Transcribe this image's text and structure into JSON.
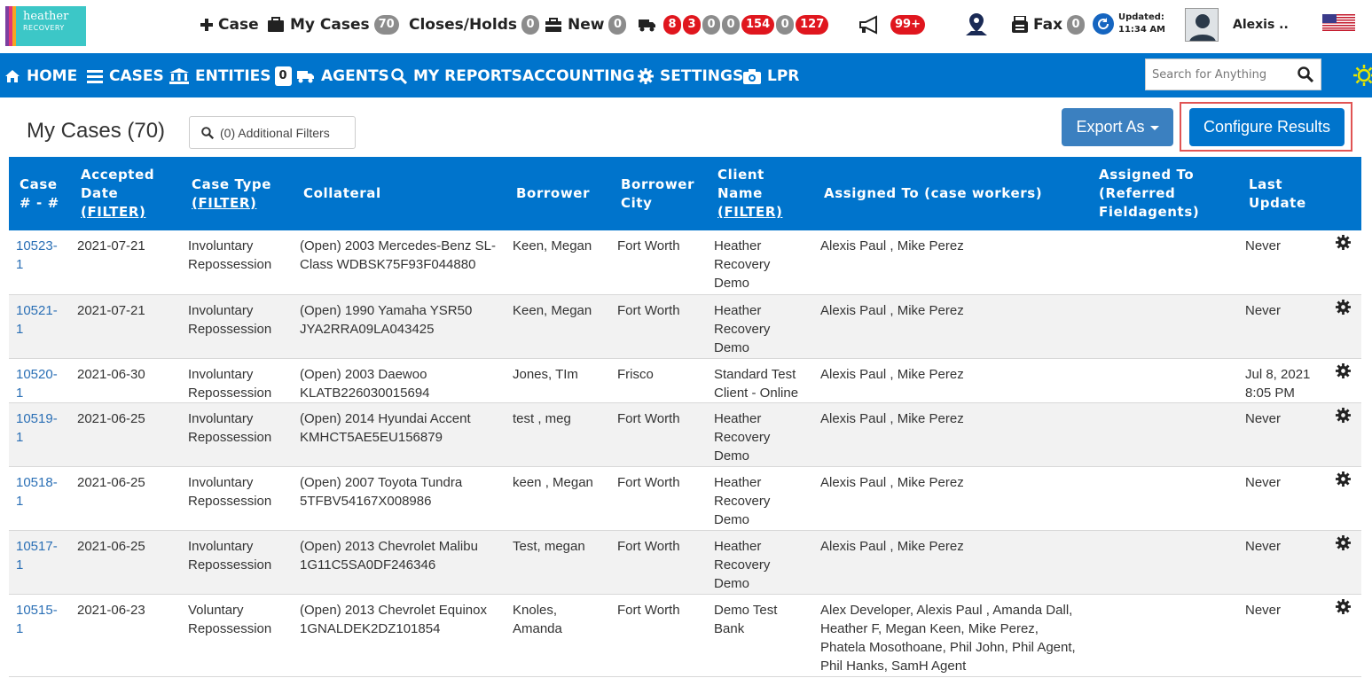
{
  "logo": {
    "line1": "heather",
    "line2": "RECOVERY",
    "stripes": [
      "#7b3fa0",
      "#e0367a",
      "#f5a623",
      "#3cc7c7"
    ]
  },
  "topbar": {
    "new_case_label": "Case",
    "my_cases_label": "My Cases",
    "my_cases_count": "70",
    "closes_holds_label": "Closes/Holds",
    "closes_holds_count": "0",
    "new_label": "New",
    "new_count": "0",
    "truck_counts": [
      "8",
      "3",
      "0",
      "0",
      "154",
      "0",
      "127"
    ],
    "notifications_count": "99+",
    "fax_label": "Fax",
    "fax_count": "0",
    "updated_label": "Updated:",
    "updated_time": "11:34 AM",
    "user_name": "Alexis .."
  },
  "nav": {
    "home": "HOME",
    "cases": "CASES",
    "entities": "ENTITIES",
    "entities_count": "0",
    "agents": "AGENTS",
    "my_reports": "MY REPORTS",
    "accounting": "ACCOUNTING",
    "settings": "SETTINGS",
    "lpr": "LPR",
    "search_placeholder": "Search for Anything"
  },
  "page": {
    "title": "My Cases (70)",
    "filters_label": "(0) Additional Filters",
    "export_label": "Export As",
    "configure_label": "Configure Results"
  },
  "table": {
    "headers": {
      "case": "Case # - #",
      "accepted": "Accepted Date",
      "case_type": "Case Type",
      "collateral": "Collateral",
      "borrower": "Borrower",
      "borrower_city": "Borrower City",
      "client": "Client Name",
      "assigned": "Assigned To (case workers)",
      "referred": "Assigned To (Referred Fieldagents)",
      "last_update": "Last Update",
      "filter": "(FILTER)"
    },
    "rows": [
      {
        "case": "10523-1",
        "accepted": "2021-07-21",
        "case_type": "Involuntary Repossession",
        "collateral": "(Open) 2003 Mercedes-Benz SL-Class WDBSK75F93F044880",
        "borrower": "Keen, Megan",
        "city": "Fort Worth",
        "client": "Heather Recovery Demo",
        "assigned": "Alexis Paul , Mike Perez",
        "referred": "",
        "last_update": "Never"
      },
      {
        "case": "10521-1",
        "accepted": "2021-07-21",
        "case_type": "Involuntary Repossession",
        "collateral": "(Open) 1990 Yamaha YSR50 JYA2RRA09LA043425",
        "borrower": "Keen, Megan",
        "city": "Fort Worth",
        "client": "Heather Recovery Demo",
        "assigned": "Alexis Paul , Mike Perez",
        "referred": "",
        "last_update": "Never"
      },
      {
        "case": "10520-1",
        "accepted": "2021-06-30",
        "case_type": "Involuntary Repossession",
        "collateral": "(Open) 2003 Daewoo KLATB226030015694",
        "borrower": "Jones, TIm",
        "city": "Frisco",
        "client": "Standard Test Client - Online",
        "assigned": "Alexis Paul , Mike Perez",
        "referred": "",
        "last_update": "Jul 8, 2021 8:05 PM"
      },
      {
        "case": "10519-1",
        "accepted": "2021-06-25",
        "case_type": "Involuntary Repossession",
        "collateral": "(Open) 2014 Hyundai Accent KMHCT5AE5EU156879",
        "borrower": "test , meg",
        "city": "Fort Worth",
        "client": "Heather Recovery Demo",
        "assigned": "Alexis Paul , Mike Perez",
        "referred": "",
        "last_update": "Never"
      },
      {
        "case": "10518-1",
        "accepted": "2021-06-25",
        "case_type": "Involuntary Repossession",
        "collateral": "(Open) 2007 Toyota Tundra 5TFBV54167X008986",
        "borrower": "keen , Megan",
        "city": "Fort Worth",
        "client": "Heather Recovery Demo",
        "assigned": "Alexis Paul , Mike Perez",
        "referred": "",
        "last_update": "Never"
      },
      {
        "case": "10517-1",
        "accepted": "2021-06-25",
        "case_type": "Involuntary Repossession",
        "collateral": "(Open) 2013 Chevrolet Malibu 1G11C5SA0DF246346",
        "borrower": "Test, megan",
        "city": "Fort Worth",
        "client": "Heather Recovery Demo",
        "assigned": "Alexis Paul , Mike Perez",
        "referred": "",
        "last_update": "Never"
      },
      {
        "case": "10515-1",
        "accepted": "2021-06-23",
        "case_type": "Voluntary Repossession",
        "collateral": "(Open) 2013 Chevrolet Equinox 1GNALDEK2DZ101854",
        "borrower": "Knoles, Amanda",
        "city": "Fort Worth",
        "client": "Demo Test Bank",
        "assigned": "Alex Developer, Alexis Paul , Amanda Dall, Heather F, Megan Keen, Mike Perez, Phatela Mosothoane, Phil John, Phil Agent, Phil Hanks, SamH Agent",
        "referred": "",
        "last_update": "Never"
      }
    ]
  },
  "colors": {
    "nav_blue": "#0074cc",
    "badge_red": "#e0161e",
    "badge_gray": "#8c8c8c",
    "link_blue": "#2a6fb5",
    "highlight_red": "#e05454"
  },
  "icons": [
    "plus-icon",
    "briefcase-icon",
    "toolbox-icon",
    "truck-icon",
    "megaphone-icon",
    "map-pin-icon",
    "fax-icon",
    "refresh-icon",
    "avatar",
    "us-flag-icon",
    "home-icon",
    "bars-icon",
    "bank-icon",
    "search-icon",
    "gear-icon",
    "camera-icon",
    "sun-icon"
  ]
}
